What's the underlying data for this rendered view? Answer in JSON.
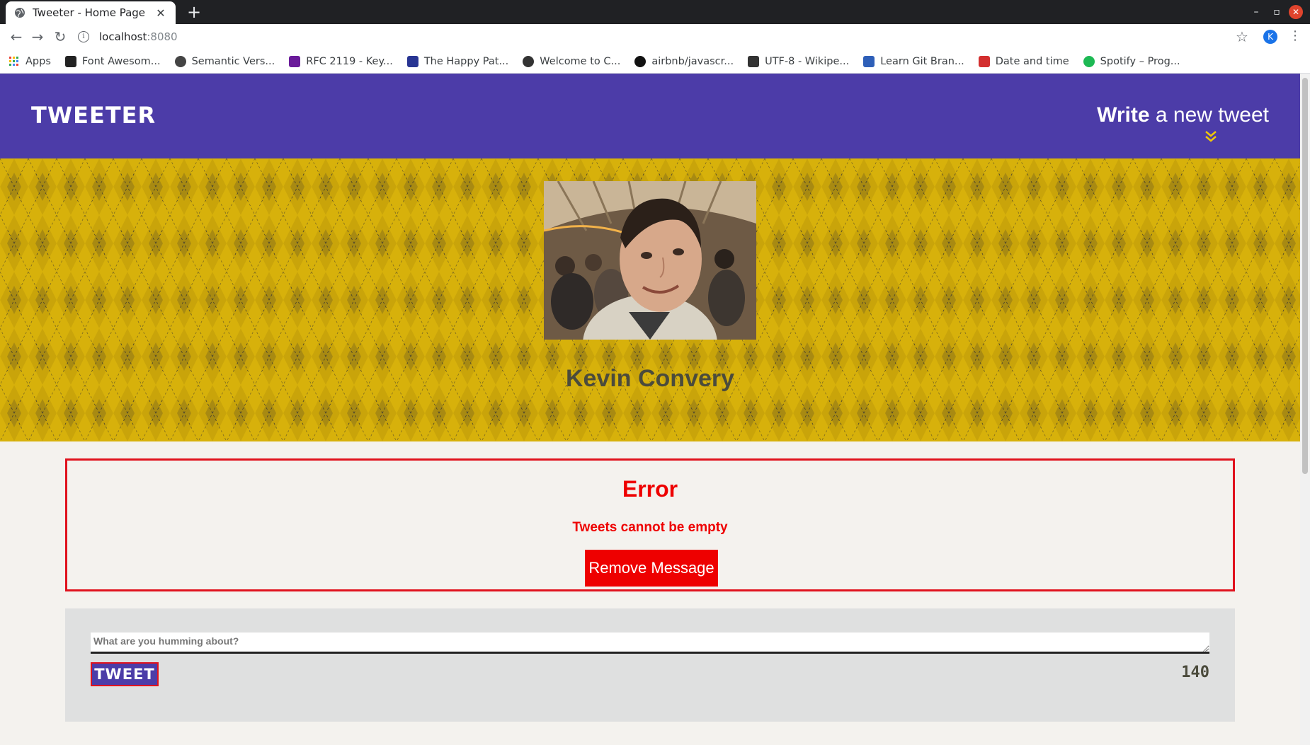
{
  "browser": {
    "tab_title": "Tweeter - Home Page",
    "new_tab_symbol": "+",
    "url_host": "localhost",
    "url_port": ":8080",
    "profile_initial": "K",
    "bookmarks": [
      {
        "label": "Apps",
        "icon": "apps-grid-icon",
        "color": "#4285f4"
      },
      {
        "label": "Font Awesom...",
        "icon": "flag-icon",
        "color": "#222222"
      },
      {
        "label": "Semantic Vers...",
        "icon": "globe-icon",
        "color": "#444444"
      },
      {
        "label": "RFC 2119 - Key...",
        "icon": "rfc-icon",
        "color": "#6a1b9a"
      },
      {
        "label": "The Happy Pat...",
        "icon": "moon-icon",
        "color": "#283593"
      },
      {
        "label": "Welcome to C...",
        "icon": "compass-icon",
        "color": "#333333"
      },
      {
        "label": "airbnb/javascr...",
        "icon": "github-icon",
        "color": "#111111"
      },
      {
        "label": "UTF-8 - Wikipe...",
        "icon": "wikipedia-icon",
        "color": "#333333"
      },
      {
        "label": "Learn Git Bran...",
        "icon": "git-icon",
        "color": "#2e5fb8"
      },
      {
        "label": "Date and time",
        "icon": "date-icon",
        "color": "#d32f2f"
      },
      {
        "label": "Spotify – Prog...",
        "icon": "spotify-icon",
        "color": "#1db954"
      }
    ]
  },
  "header": {
    "brand": "TWEETER",
    "compose_strong": "Write",
    "compose_rest": " a new tweet"
  },
  "profile": {
    "name": "Kevin Convery"
  },
  "error": {
    "title": "Error",
    "message": "Tweets cannot be empty",
    "button_label": "Remove Message"
  },
  "composer": {
    "placeholder": "What are you humming about?",
    "submit_label": "TWEET",
    "char_count": "140"
  },
  "colors": {
    "nav_bg": "#4c3ca8",
    "hero_yellow": "#f0c808",
    "error_red": "#ee0000",
    "page_bg": "#f4f2ee"
  }
}
